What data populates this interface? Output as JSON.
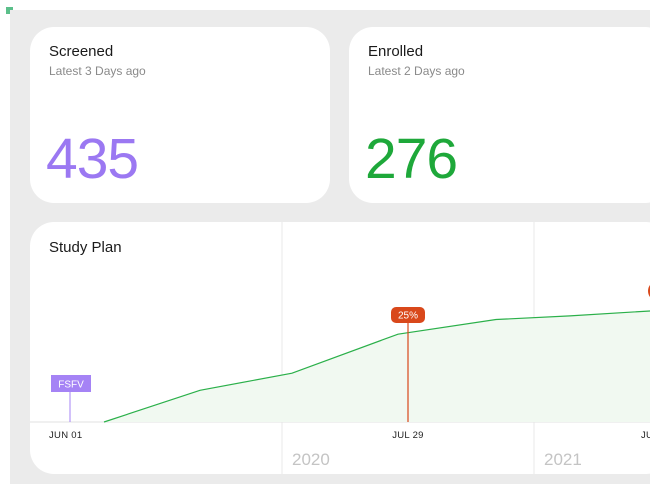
{
  "colors": {
    "screened": "#9b78f2",
    "enrolled": "#1ea83a",
    "line": "#2bb04a",
    "area": "#f1f9f1",
    "milestone": "#d9481b",
    "fsfv": "#a583f5",
    "grid": "#e8e8e8",
    "year_label": "#c4c4c4"
  },
  "cards": [
    {
      "title": "Screened",
      "subtitle": "Latest 3 Days ago",
      "value": "435"
    },
    {
      "title": "Enrolled",
      "subtitle": "Latest 2 Days ago",
      "value": "276"
    }
  ],
  "study_plan": {
    "title": "Study Plan",
    "x_labels": [
      "JUN 01",
      "JUL 29",
      "JU"
    ],
    "year_labels": [
      "2020",
      "2021"
    ],
    "fsfv_label": "FSFV",
    "milestone_label": "25%"
  },
  "chart_data": {
    "type": "area",
    "title": "Study Plan",
    "xlabel": "",
    "ylabel": "",
    "x": [
      0,
      1,
      2,
      3,
      4,
      5,
      6
    ],
    "series": [
      {
        "values": [
          0,
          0.26,
          0.4,
          0.72,
          0.84,
          0.87,
          0.92
        ]
      }
    ],
    "ylim": [
      0,
      1
    ],
    "markers": [
      {
        "label": "FSFV",
        "x": 0
      },
      {
        "label": "25%",
        "x": 3
      }
    ]
  }
}
